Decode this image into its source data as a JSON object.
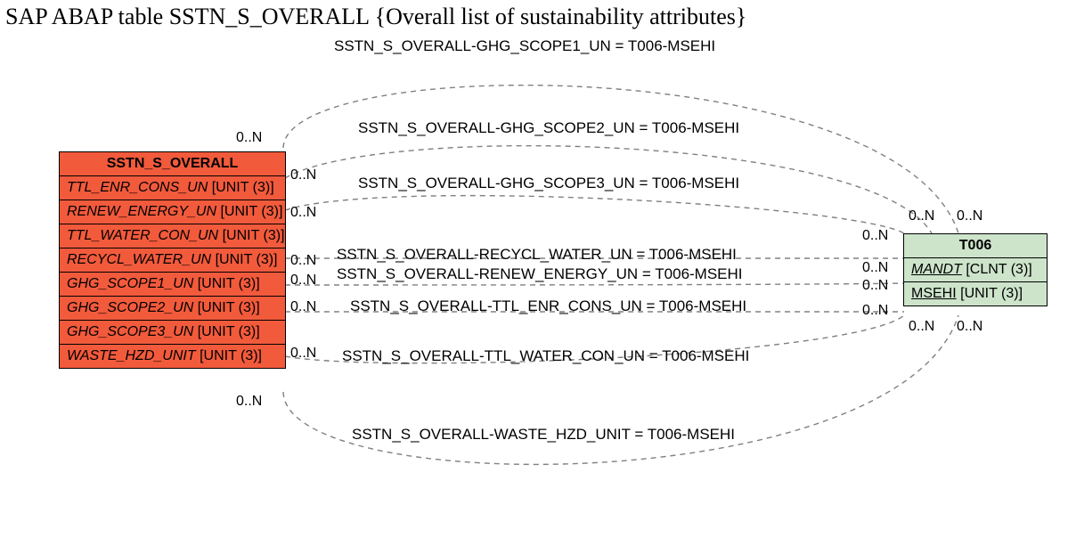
{
  "title": "SAP ABAP table SSTN_S_OVERALL {Overall list of sustainability attributes}",
  "sstn": {
    "name": "SSTN_S_OVERALL",
    "rows": [
      {
        "name": "TTL_ENR_CONS_UN",
        "type": "[UNIT (3)]"
      },
      {
        "name": "RENEW_ENERGY_UN",
        "type": "[UNIT (3)]"
      },
      {
        "name": "TTL_WATER_CON_UN",
        "type": "[UNIT (3)]"
      },
      {
        "name": "RECYCL_WATER_UN",
        "type": "[UNIT (3)]"
      },
      {
        "name": "GHG_SCOPE1_UN",
        "type": "[UNIT (3)]"
      },
      {
        "name": "GHG_SCOPE2_UN",
        "type": "[UNIT (3)]"
      },
      {
        "name": "GHG_SCOPE3_UN",
        "type": "[UNIT (3)]"
      },
      {
        "name": "WASTE_HZD_UNIT",
        "type": "[UNIT (3)]"
      }
    ]
  },
  "t006": {
    "name": "T006",
    "rows": [
      {
        "name": "MANDT",
        "type": "[CLNT (3)]",
        "key": true
      },
      {
        "name": "MSEHI",
        "type": "[UNIT (3)]",
        "key": true
      }
    ]
  },
  "relations": [
    "SSTN_S_OVERALL-GHG_SCOPE1_UN = T006-MSEHI",
    "SSTN_S_OVERALL-GHG_SCOPE2_UN = T006-MSEHI",
    "SSTN_S_OVERALL-GHG_SCOPE3_UN = T006-MSEHI",
    "SSTN_S_OVERALL-RECYCL_WATER_UN = T006-MSEHI",
    "SSTN_S_OVERALL-RENEW_ENERGY_UN = T006-MSEHI",
    "SSTN_S_OVERALL-TTL_ENR_CONS_UN = T006-MSEHI",
    "SSTN_S_OVERALL-TTL_WATER_CON_UN = T006-MSEHI",
    "SSTN_S_OVERALL-WASTE_HZD_UNIT = T006-MSEHI"
  ],
  "cardinality": "0..N"
}
